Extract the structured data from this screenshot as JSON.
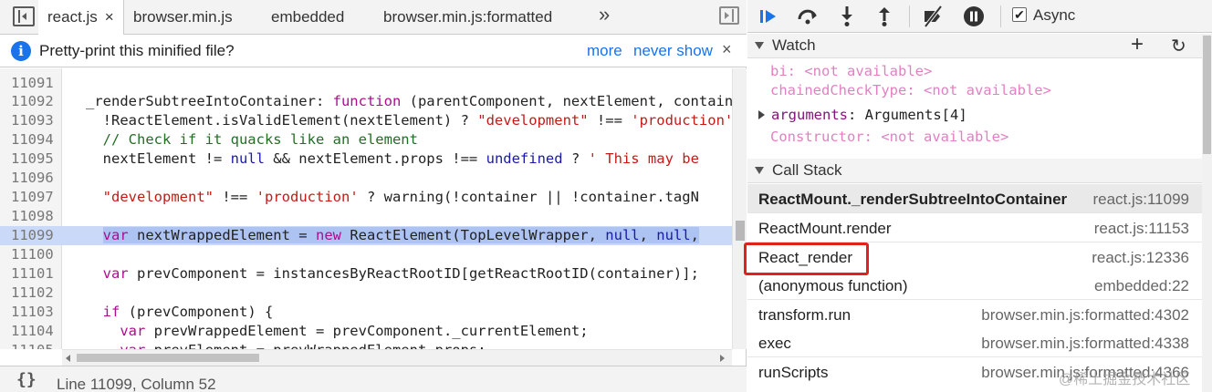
{
  "tabs": [
    {
      "label": "react.js",
      "close": "×",
      "active": true
    },
    {
      "label": "browser.min.js"
    },
    {
      "label": "embedded"
    },
    {
      "label": "browser.min.js:formatted"
    }
  ],
  "tabs_more": "»",
  "infobar": {
    "message": "Pretty-print this minified file?",
    "more": "more",
    "never_show": "never show",
    "close": "×"
  },
  "code_lines": [
    {
      "num": "11091",
      "code": ""
    },
    {
      "num": "11092",
      "code": "_renderSubtreeIntoContainer: function (parentComponent, nextElement, container"
    },
    {
      "num": "11093",
      "code": "  !ReactElement.isValidElement(nextElement) ? \"development\" !== 'production'"
    },
    {
      "num": "11094",
      "code": "  // Check if it quacks like an element"
    },
    {
      "num": "11095",
      "code": "  nextElement != null && nextElement.props !== undefined ? ' This may be"
    },
    {
      "num": "11096",
      "code": ""
    },
    {
      "num": "11097",
      "code": "  \"development\" !== 'production' ? warning(!container || !container.tagN"
    },
    {
      "num": "11098",
      "code": ""
    },
    {
      "num": "11099",
      "code": "  var nextWrappedElement = new ReactElement(TopLevelWrapper, null, null,"
    },
    {
      "num": "11100",
      "code": ""
    },
    {
      "num": "11101",
      "code": "  var prevComponent = instancesByReactRootID[getReactRootID(container)];"
    },
    {
      "num": "11102",
      "code": ""
    },
    {
      "num": "11103",
      "code": "  if (prevComponent) {"
    },
    {
      "num": "11104",
      "code": "    var prevWrappedElement = prevComponent._currentElement;"
    },
    {
      "num": "11105",
      "code": "    var prevElement = prevWrappedElement.props;"
    }
  ],
  "status": {
    "braces": "{}",
    "position": "Line 11099, Column 52"
  },
  "debugger": {
    "async_label": "Async",
    "async_checked": true,
    "icons": [
      "resume-icon",
      "step-over-icon",
      "step-into-icon",
      "step-out-icon",
      "deactivate-breakpoints-icon",
      "pause-on-exceptions-icon"
    ]
  },
  "watch": {
    "title": "Watch",
    "add": "+",
    "refresh": "↻",
    "items": [
      {
        "name": "bi",
        "value": "<not available>"
      },
      {
        "name": "chainedCheckType",
        "value": "<not available>"
      },
      {
        "name": "arguments",
        "value": "Arguments[4]",
        "expandable": true
      },
      {
        "name": "Constructor",
        "value": "<not available>"
      }
    ]
  },
  "call_stack": {
    "title": "Call Stack",
    "frames": [
      {
        "name": "ReactMount._renderSubtreeIntoContainer",
        "location": "react.js:11099",
        "selected": true
      },
      {
        "name": "ReactMount.render",
        "location": "react.js:11153"
      },
      {
        "name": "React_render",
        "location": "react.js:12336",
        "highlighted": true
      },
      {
        "name": "(anonymous function)",
        "location": "embedded:22"
      },
      {
        "name": "transform.run",
        "location": "browser.min.js:formatted:4302"
      },
      {
        "name": "exec",
        "location": "browser.min.js:formatted:4338"
      },
      {
        "name": "runScripts",
        "location": "browser.min.js:formatted:4366"
      }
    ]
  },
  "watermark": "@稀土掘金技术社区",
  "colors": {
    "accent_blue": "#1a73e8",
    "annotation_red": "#e0211c",
    "keyword": "#aa0d91",
    "string": "#c41a16",
    "comment": "#236e25"
  }
}
